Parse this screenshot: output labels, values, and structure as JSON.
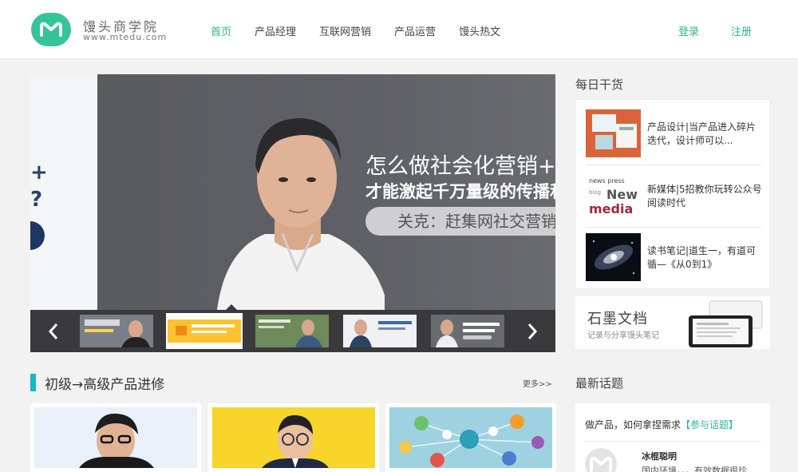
{
  "brand": {
    "name": "馒头商学院",
    "url": "www.mtedu.com",
    "color": "#35c39a"
  },
  "nav": {
    "items": [
      {
        "label": "首页",
        "active": true
      },
      {
        "label": "产品经理",
        "active": false
      },
      {
        "label": "互联网营销",
        "active": false
      },
      {
        "label": "产品运营",
        "active": false
      },
      {
        "label": "馒头热文",
        "active": false
      }
    ],
    "login": "登录",
    "register": "注册"
  },
  "banner": {
    "line1": "怎么做社会化营销+内容营",
    "line2": "才能激起千万量级的传播和分",
    "line3": "关克：赶集网社交营销总监"
  },
  "courses": {
    "section_title": "初级→高级产品进修",
    "more": "更多>>"
  },
  "daily": {
    "title": "每日干货",
    "items": [
      {
        "title": "产品设计|当产品进入碎片迭代，设计师可以..."
      },
      {
        "title": "新媒体|5招教你玩转公众号阅读时代"
      },
      {
        "title": "读书笔记|道生一，有道可循—《从0到1》"
      }
    ]
  },
  "shimo": {
    "name": "石墨文档",
    "desc": "记录与分享馒头笔记"
  },
  "topics": {
    "title": "最新话题",
    "question": "做产品，如何拿捏需求",
    "join": "【参与话题】",
    "user": "冰棍聪明",
    "excerpt": "国内环境。。。有效数据很珍"
  }
}
